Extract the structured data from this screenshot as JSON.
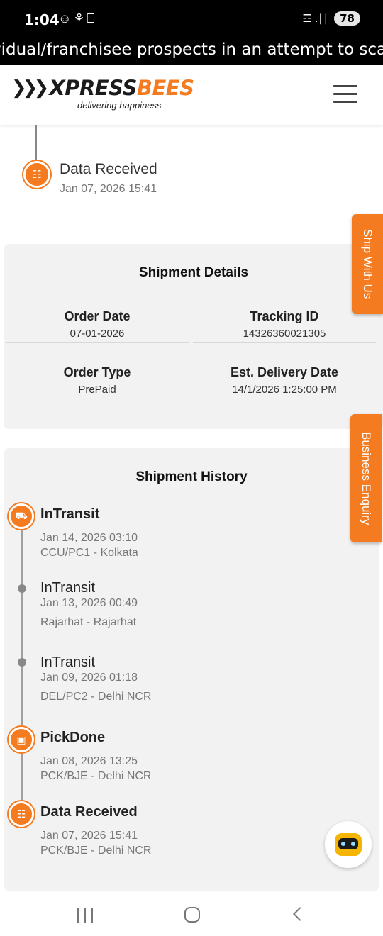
{
  "status_bar": {
    "time": "1:04",
    "left_icons": "☺⚘⎕",
    "signal": "☲ .∣∣",
    "battery": "78"
  },
  "ticker": {
    "text": "vidual/franchisee prospects in an attempt to scam t"
  },
  "header": {
    "logo_text_1": "XPRESS",
    "logo_text_2": "BEES",
    "logo_tagline": "delivering happiness",
    "menu_icon": "hamburger-icon"
  },
  "top_event": {
    "title": "Data Received",
    "date": "Jan 07, 2026 15:41"
  },
  "shipment_details": {
    "title": "Shipment Details",
    "order_date_label": "Order Date",
    "order_date_value": "07-01-2026",
    "tracking_id_label": "Tracking ID",
    "tracking_id_value": "14326360021305",
    "order_type_label": "Order Type",
    "order_type_value": "PrePaid",
    "est_delivery_label": "Est. Delivery Date",
    "est_delivery_value": "14/1/2026 1:25:00 PM"
  },
  "shipment_history": {
    "title": "Shipment History",
    "events": [
      {
        "status": "InTransit",
        "date": "Jan 14, 2026 03:10",
        "location": "CCU/PC1 - Kolkata"
      },
      {
        "status": "InTransit",
        "date": "Jan 13, 2026 00:49",
        "location": "Rajarhat - Rajarhat"
      },
      {
        "status": "InTransit",
        "date": "Jan 09, 2026 01:18",
        "location": "DEL/PC2 - Delhi NCR"
      },
      {
        "status": "PickDone",
        "date": "Jan 08, 2026 13:25",
        "location": "PCK/BJE - Delhi NCR"
      },
      {
        "status": "Data Received",
        "date": "Jan 07, 2026 15:41",
        "location": "PCK/BJE - Delhi NCR"
      }
    ]
  },
  "side_tabs": {
    "ship_with_us": "Ship With Us",
    "business_enquiry": "Business Enquiry"
  },
  "colors": {
    "accent": "#f47b20",
    "card_bg": "#f2f2f2"
  }
}
